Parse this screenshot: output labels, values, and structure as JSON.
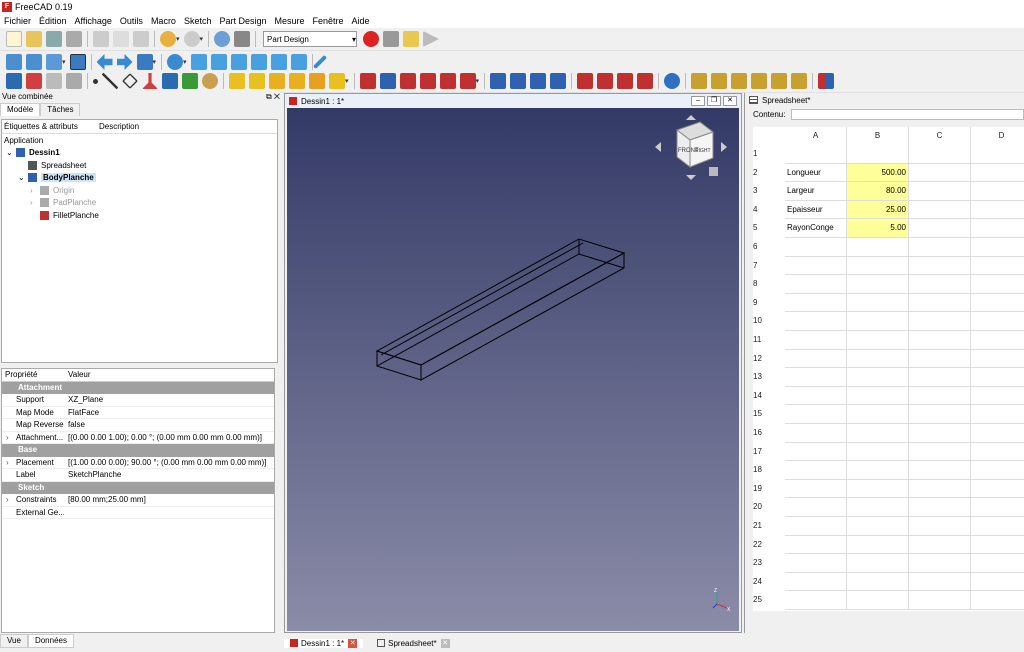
{
  "window": {
    "title": "FreeCAD 0.19"
  },
  "menu": [
    "Fichier",
    "Édition",
    "Affichage",
    "Outils",
    "Macro",
    "Sketch",
    "Part Design",
    "Mesure",
    "Fenêtre",
    "Aide"
  ],
  "toolbar": {
    "workbench": "Part Design"
  },
  "combo": {
    "title": "Vue combinée",
    "tabs": [
      "Modèle",
      "Tâches"
    ],
    "tree_headers": [
      "Étiquettes & attributs",
      "Description"
    ],
    "tree": [
      {
        "label": "Application",
        "indent": 0,
        "icon": "none"
      },
      {
        "label": "Dessin1",
        "indent": 1,
        "icon": "document-icon",
        "bold": true
      },
      {
        "label": "Spreadsheet",
        "indent": 2,
        "icon": "spreadsheet-icon"
      },
      {
        "label": "BodyPlanche",
        "indent": 2,
        "icon": "body-icon",
        "bold": true,
        "selected": true
      },
      {
        "label": "Origin",
        "indent": 3,
        "icon": "origin-icon",
        "grey": true
      },
      {
        "label": "PadPlanche",
        "indent": 3,
        "icon": "pad-icon",
        "grey": true
      },
      {
        "label": "FilletPlanche",
        "indent": 3,
        "icon": "fillet-icon"
      }
    ],
    "props_headers": [
      "Propriété",
      "Valeur"
    ],
    "props": [
      {
        "group": "Attachment"
      },
      {
        "k": "Support",
        "v": "XZ_Plane"
      },
      {
        "k": "Map Mode",
        "v": "FlatFace"
      },
      {
        "k": "Map Reversed",
        "v": "false"
      },
      {
        "k": "Attachment...",
        "v": "[(0.00 0.00 1.00); 0.00 °; (0.00 mm  0.00 mm  0.00 mm)]",
        "arrow": true
      },
      {
        "group": "Base"
      },
      {
        "k": "Placement",
        "v": "[(1.00 0.00 0.00); 90.00 °; (0.00 mm  0.00 mm  0.00 mm)]",
        "arrow": true
      },
      {
        "k": "Label",
        "v": "SketchPlanche"
      },
      {
        "group": "Sketch"
      },
      {
        "k": "Constraints",
        "v": "[80.00 mm;25.00 mm]",
        "arrow": true
      },
      {
        "k": "External Ge...",
        "v": ""
      }
    ],
    "bottom_tabs": [
      "Vue",
      "Données"
    ]
  },
  "view": {
    "title": "Dessin1 : 1*"
  },
  "sheet": {
    "title": "Spreadsheet*",
    "contenu_label": "Contenu:",
    "columns": [
      "A",
      "B",
      "C",
      "D"
    ],
    "rows": [
      "1",
      "2",
      "3",
      "4",
      "5",
      "6",
      "7",
      "8",
      "9",
      "10",
      "11",
      "12",
      "13",
      "14",
      "15",
      "16",
      "17",
      "18",
      "19",
      "20",
      "21",
      "22",
      "23",
      "24",
      "25"
    ],
    "cells": [
      {
        "row": 2,
        "a": "Longueur",
        "b": "500.00"
      },
      {
        "row": 3,
        "a": "Largeur",
        "b": "80.00"
      },
      {
        "row": 4,
        "a": "Epaisseur",
        "b": "25.00"
      },
      {
        "row": 5,
        "a": "RayonConge",
        "b": "5.00"
      }
    ]
  },
  "doc_tabs": [
    "Dessin1 : 1*",
    "Spreadsheet*"
  ]
}
